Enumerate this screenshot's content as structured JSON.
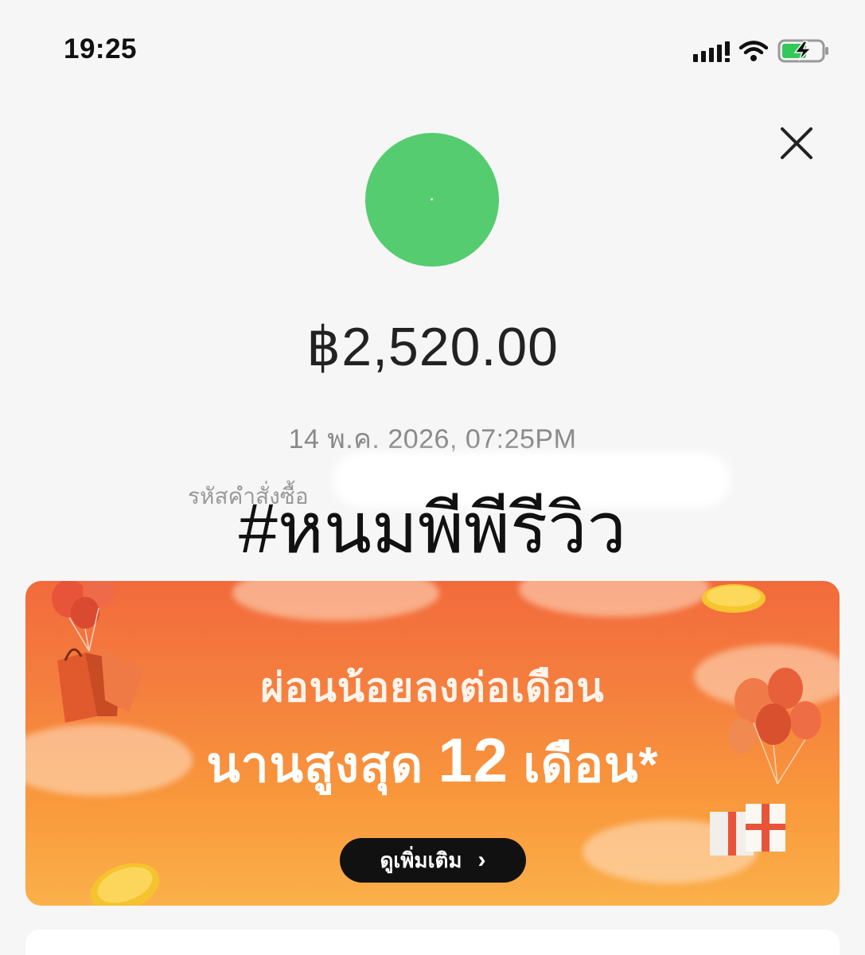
{
  "status_bar": {
    "time": "19:25",
    "icons": [
      "cellular-signal-icon",
      "wifi-icon",
      "battery-charging-icon"
    ],
    "battery_color": "#34c759"
  },
  "header": {
    "close_icon": "close-icon"
  },
  "payment": {
    "avatar_color": "#55cc70",
    "amount": "฿2,520.00",
    "datetime": "14 พ.ค. 2026, 07:25PM",
    "order_label": "รหัสคำสั่งซื้อ"
  },
  "overlay": {
    "hashtag": "#หนมพีพีรีวิว"
  },
  "banner": {
    "line1": "ผ่อนน้อยลงต่อเดือน",
    "line2_prefix": "นานสูงสุด",
    "line2_number": "12",
    "line2_suffix": "เดือน*",
    "button_label": "ดูเพิ่มเติม",
    "button_icon": "chevron-right-icon",
    "colors": {
      "top": "#f26a3c",
      "bottom": "#fbb04a",
      "button": "#111111"
    }
  }
}
